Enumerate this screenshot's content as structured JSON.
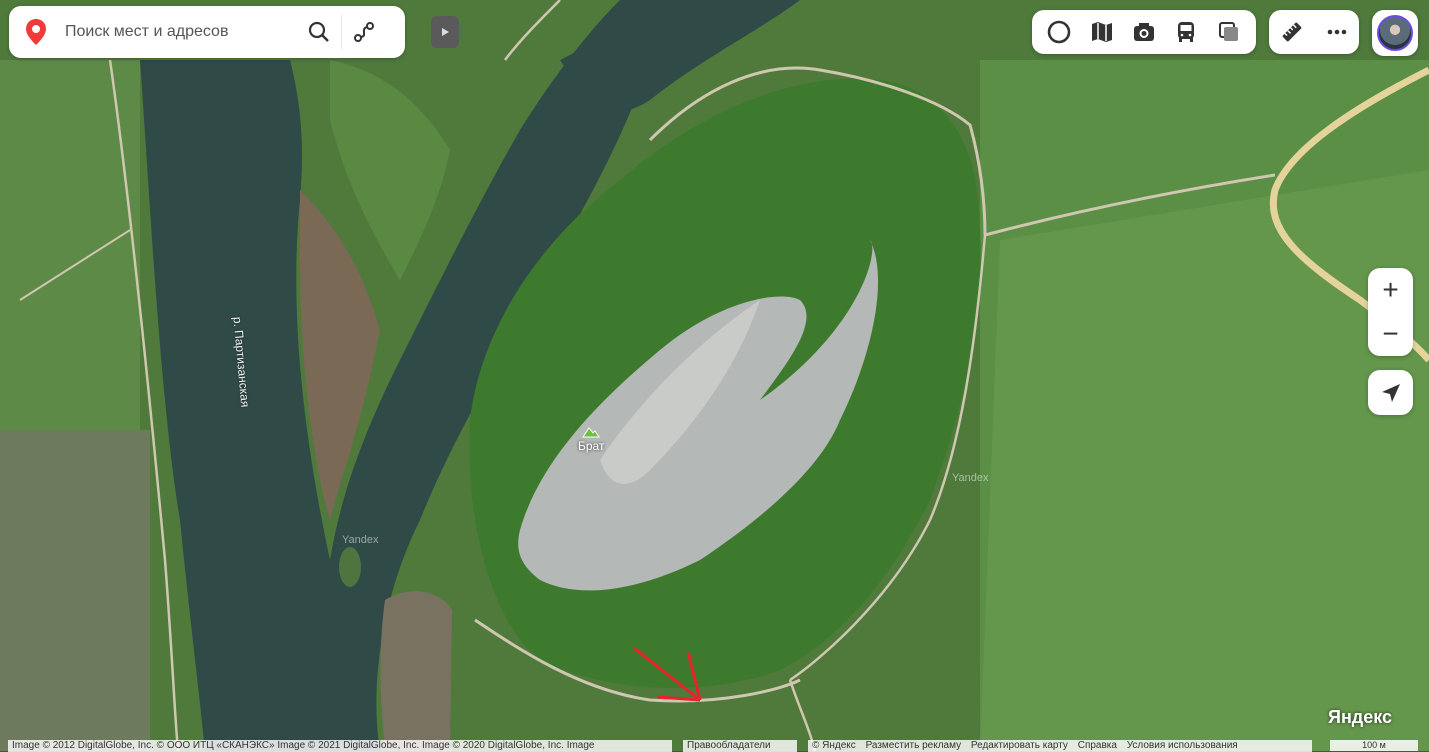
{
  "search": {
    "placeholder": "Поиск мест и адресов"
  },
  "icons": {
    "pin": "location-pin-icon",
    "search": "search-icon",
    "route": "route-icon",
    "collapse": "play-triangle-icon",
    "layers": [
      "panorama-circle-icon",
      "map-book-icon",
      "camera-icon",
      "bus-icon",
      "layers-square-icon"
    ],
    "tools": [
      "ruler-icon",
      "more-dots-icon"
    ],
    "zoom_in": "+",
    "zoom_out": "−",
    "locate": "navigation-arrow-icon"
  },
  "map": {
    "river_label": "р. Партизанская",
    "poi_name": "Брат",
    "watermark": "Yandex",
    "logo": "Яндекс"
  },
  "footer": {
    "imagery": "Image © 2012 DigitalGlobe, Inc. © ООО ИТЦ «СКАНЭКС» Image © 2021 DigitalGlobe, Inc. Image © 2020 DigitalGlobe, Inc. Image",
    "rights": "Правообладатели",
    "links": [
      "© Яндекс",
      "Разместить рекламу",
      "Редактировать карту",
      "Справка",
      "Условия использования"
    ],
    "scale": "100 м"
  },
  "colors": {
    "pin": "#f33a3a",
    "arrow": "#e8232a",
    "road": "#e4d39a"
  }
}
